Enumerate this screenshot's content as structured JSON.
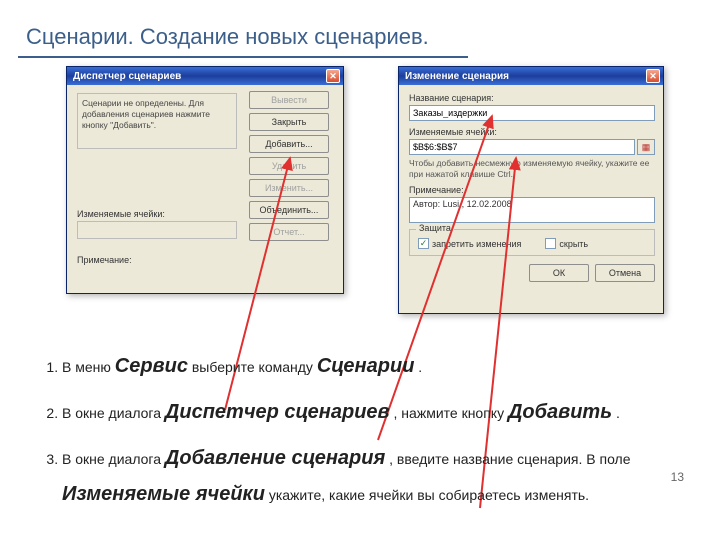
{
  "title": "Сценарии. Создание новых сценариев.",
  "page_number": "13",
  "dialog1": {
    "title": "Диспетчер сценариев",
    "message": "Сценарии не определены. Для добавления сценариев нажмите кнопку \"Добавить\".",
    "changing_cells_label": "Изменяемые ячейки:",
    "note_label": "Примечание:",
    "buttons": {
      "show": "Вывести",
      "close": "Закрыть",
      "add": "Добавить...",
      "delete": "Удалить",
      "edit": "Изменить...",
      "merge": "Объединить...",
      "summary": "Отчет..."
    }
  },
  "dialog2": {
    "title": "Изменение сценария",
    "name_label": "Название сценария:",
    "name_value": "Заказы_издержки",
    "cells_label": "Изменяемые ячейки:",
    "cells_value": "$B$6:$B$7",
    "hint": "Чтобы добавить несмежную изменяемую ячейку, укажите ее при нажатой клавише Ctrl.",
    "note_label": "Примечание:",
    "note_value": "Автор: Lusi , 12.02.2008",
    "group_label": "Защита",
    "cb1_label": "запретить изменения",
    "cb2_label": "скрыть",
    "ok": "ОК",
    "cancel": "Отмена"
  },
  "steps": {
    "s1_a": "В меню ",
    "s1_b": "Сервис",
    "s1_c": " выберите команду ",
    "s1_d": "Сценарии",
    "s1_e": ".",
    "s2_a": " В окне диалога ",
    "s2_b": "Диспетчер сценариев",
    "s2_c": ", нажмите кнопку ",
    "s2_d": "Добавить",
    "s2_e": " .",
    "s3_a": " В окне диалога ",
    "s3_b": "Добавление сценария",
    "s3_c": ", введите название сценария. В поле ",
    "s3_d": "Изменяемые ячейки",
    "s3_e": " укажите, какие ячейки вы собираетесь изменять."
  }
}
